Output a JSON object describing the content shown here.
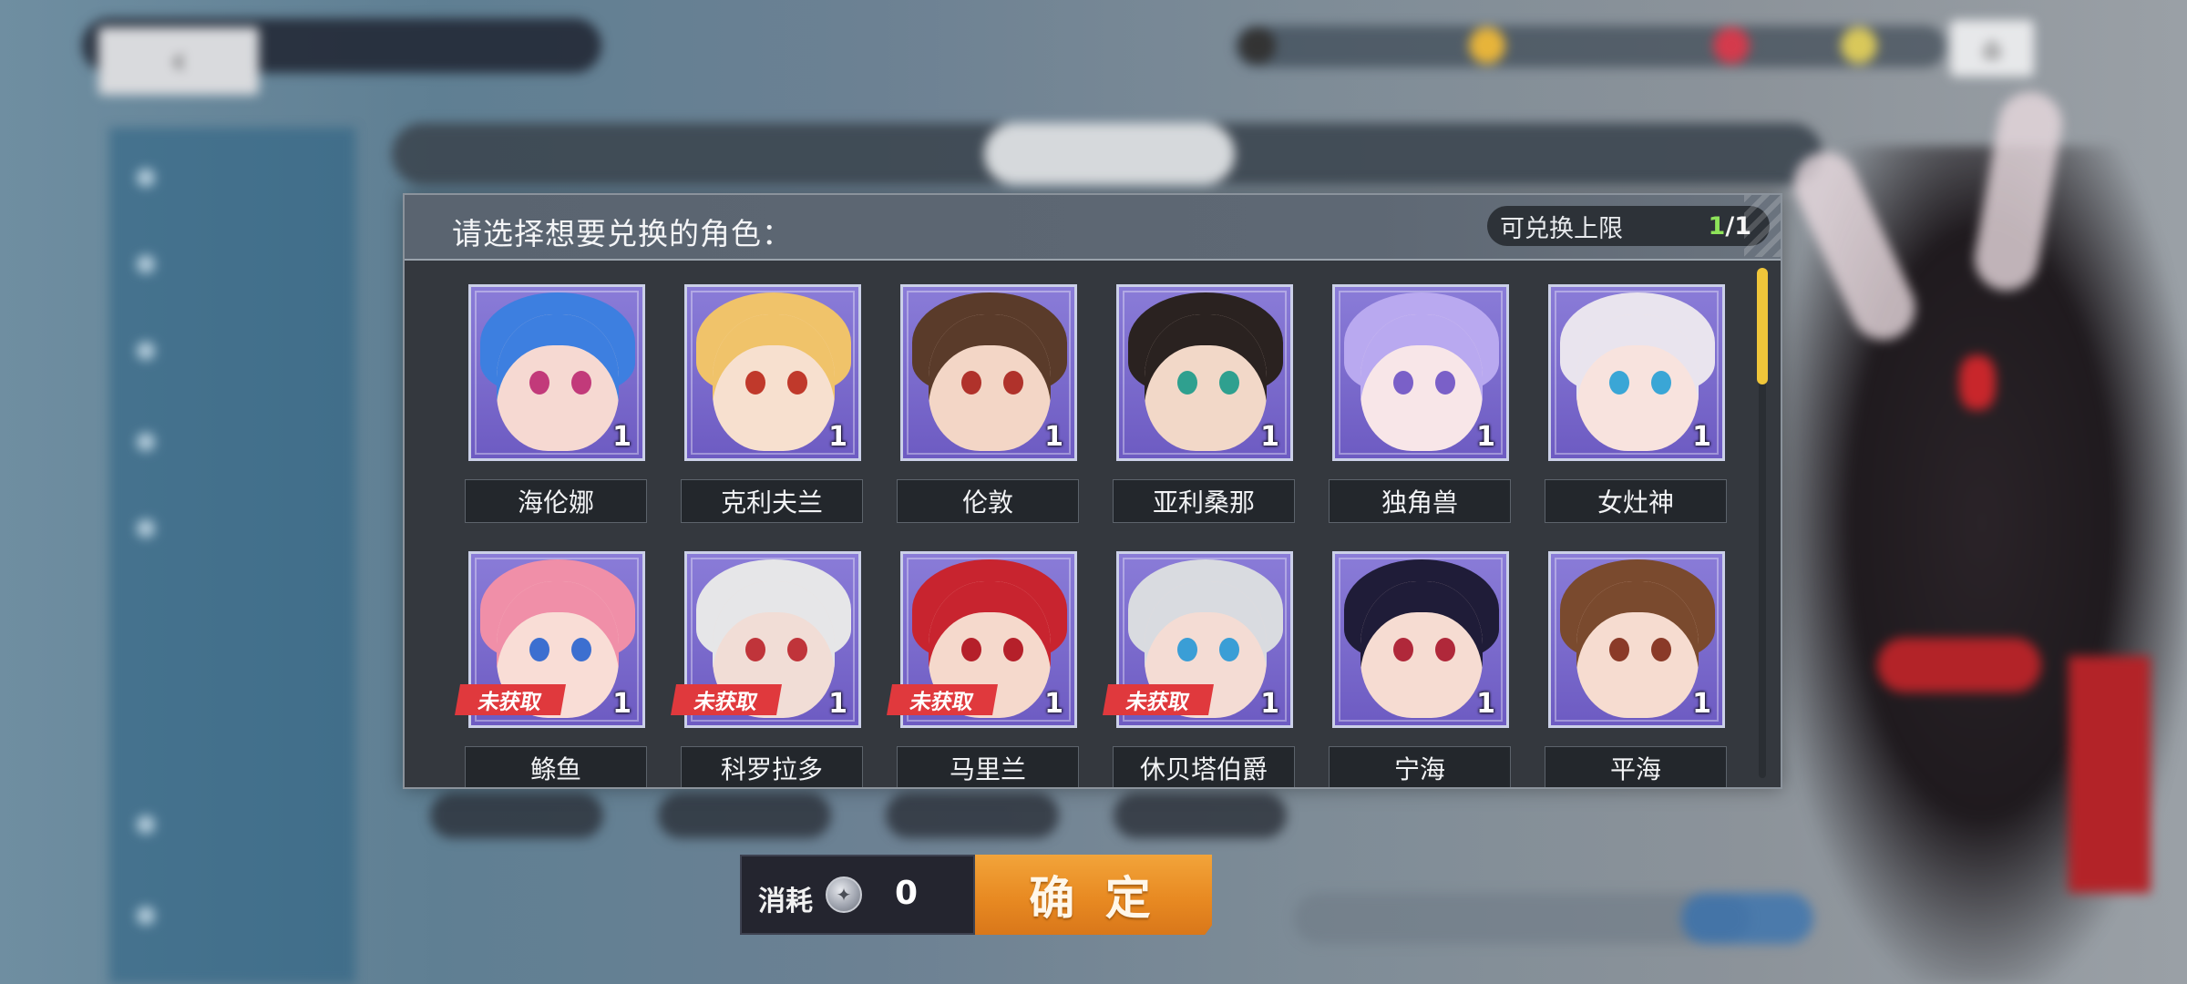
{
  "background": {
    "back_icon": "chevron-left-icon",
    "home_icon": "home-icon"
  },
  "dialog": {
    "title": "请选择想要兑换的角色：",
    "limit_label": "可兑换上限",
    "limit_current": "1",
    "limit_total": "/1",
    "untaken_tag": "未获取",
    "characters": [
      {
        "name": "海伦娜",
        "count": "1",
        "owned": true,
        "hair": "#3d7fe0",
        "skin": "#f6d9d2",
        "eye": "#c23a7a"
      },
      {
        "name": "克利夫兰",
        "count": "1",
        "owned": true,
        "hair": "#f0c36a",
        "skin": "#f7e0cf",
        "eye": "#c0392b"
      },
      {
        "name": "伦敦",
        "count": "1",
        "owned": true,
        "hair": "#5a3b2a",
        "skin": "#f3d6c6",
        "eye": "#b0322b"
      },
      {
        "name": "亚利桑那",
        "count": "1",
        "owned": true,
        "hair": "#2a2220",
        "skin": "#f2d8c8",
        "eye": "#2fa08f"
      },
      {
        "name": "独角兽",
        "count": "1",
        "owned": true,
        "hair": "#b9a9f0",
        "skin": "#f8e6e8",
        "eye": "#7a60c8"
      },
      {
        "name": "女灶神",
        "count": "1",
        "owned": true,
        "hair": "#e9e4ee",
        "skin": "#f8e3de",
        "eye": "#3aa6d6"
      },
      {
        "name": "鲦鱼",
        "count": "1",
        "owned": false,
        "hair": "#f08fa8",
        "skin": "#f9ddd6",
        "eye": "#3c6fd0"
      },
      {
        "name": "科罗拉多",
        "count": "1",
        "owned": false,
        "hair": "#e6e6e8",
        "skin": "#f1ddd6",
        "eye": "#c0343a"
      },
      {
        "name": "马里兰",
        "count": "1",
        "owned": false,
        "hair": "#c8242f",
        "skin": "#f5d9cc",
        "eye": "#b5202a"
      },
      {
        "name": "休贝塔伯爵",
        "count": "1",
        "owned": false,
        "hair": "#d9dbe0",
        "skin": "#f4dcd4",
        "eye": "#3a9ed6"
      },
      {
        "name": "宁海",
        "count": "1",
        "owned": true,
        "hair": "#1f1c38",
        "skin": "#f6dcd2",
        "eye": "#b0283a"
      },
      {
        "name": "平海",
        "count": "1",
        "owned": true,
        "hair": "#7a4a2e",
        "skin": "#f6dcd0",
        "eye": "#8a3a28"
      }
    ]
  },
  "footer": {
    "cost_label": "消耗",
    "cost_icon": "silver-coin-icon",
    "cost_value": "0",
    "confirm_label": "确 定"
  },
  "colors": {
    "confirm_orange": "#e88a22",
    "untaken_red": "#e0393d",
    "limit_green": "#8ee35a",
    "scroll_yellow": "#f0c63a"
  }
}
